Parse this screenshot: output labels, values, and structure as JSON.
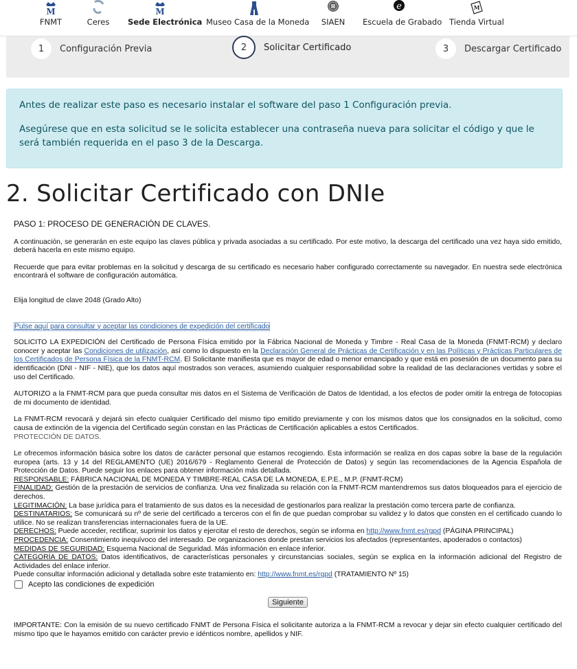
{
  "nav": {
    "items": [
      {
        "label": "FNMT"
      },
      {
        "label": "Ceres"
      },
      {
        "label": "Sede Electrónica"
      },
      {
        "label": "Museo Casa de la Moneda"
      },
      {
        "label": "SIAEN"
      },
      {
        "label": "Escuela de Grabado"
      },
      {
        "label": "Tienda Virtual"
      }
    ]
  },
  "steps": [
    {
      "num": "1",
      "label": "Configuración Previa"
    },
    {
      "num": "2",
      "label": "Solicitar Certificado"
    },
    {
      "num": "3",
      "label": "Descargar Certificado"
    }
  ],
  "alert": {
    "p1": "Antes de realizar este paso es necesario instalar el software del paso 1 Configuración previa.",
    "p2": "Asegúrese que en esta solicitud se le solicita establecer una contraseña nueva para solicitar el código y que le será también requerida en el paso 3 de la Descarga."
  },
  "title": "2. Solicitar Certificado con DNIe",
  "content": {
    "paso1": "PASO 1: PROCESO DE GENERACIÓN DE CLAVES.",
    "intro1": "A continuación, se generarán en este equipo las claves pública y privada asociadas a su certificado. Por este motivo, la descarga del certificado una vez haya sido emitido, deberá hacerla en este mismo equipo.",
    "intro2": "Recuerde que para evitar problemas en la solicitud y descarga de su certificado es necesario haber configurado correctamente su navegador. En nuestra sede electrónica encontrará el software de configuración automática.",
    "key_length": "Elija longitud de clave 2048  (Grado Alto)",
    "conditions_link": "Pulse aquí para consultar y aceptar las condiciones de expedición del certificado",
    "solicito_a": "SOLICITO LA EXPEDICIÓN del Certificado de Persona Física emitido por la Fábrica Nacional de Moneda y Timbre - Real Casa de la Moneda (FNMT-RCM) y declaro conocer y aceptar las ",
    "solicito_link1": "Condiciones de utilización",
    "solicito_b": ", así como lo dispuesto en la ",
    "solicito_link2": "Declaración General de Prácticas de Certificación y en las Políticas y Prácticas Particulares de los Certificados de Persona Física de la FNMT-RCM",
    "solicito_c": ". El Solicitante manifiesta que es mayor de edad o menor emancipado y que está en posesión de un documento para su identificación (DNI - NIF - NIE), que los datos aquí mostrados son veraces, asumiendo cualquier responsabilidad sobre la realidad de las declaraciones vertidas y sobre el uso del Certificado.",
    "autorizo": "AUTORIZO a la FNMT-RCM para que pueda consultar mis datos en el Sistema de Verificación de Datos de Identidad, a los efectos de poder omitir la entrega de fotocopias de mi documento de identidad.",
    "revocara": "La FNMT-RCM revocará y dejará sin efecto cualquier Certificado del mismo tipo emitido previamente y con los mismos datos que los consignados en la solicitud, como causa de extinción de la vigencia del Certificado según constan en las Prácticas de Certificación aplicables a estos Certificados.",
    "proteccion": "PROTECCIÓN DE DATOS.",
    "ofrecemos": "Le ofrecemos información básica sobre los datos de carácter personal que estamos recogiendo. Esta información se realiza en dos capas sobre la base de la regulación europea (arts. 13 y 14 del REGLAMENTO (UE) 2016/679 - Reglamento General de Protección de Datos) y según las recomendaciones de la Agencia Española de Protección de Datos. Puede seguir los enlaces para obtener información más detallada.",
    "responsable_k": "RESPONSABLE:",
    "responsable_v": " FÁBRICA NACIONAL DE MONEDA Y TIMBRE-REAL CASA DE LA MONEDA, E.P.E., M.P. (FNMT-RCM)",
    "finalidad_k": "FINALIDAD:",
    "finalidad_v": " Gestión de la prestación de servicios de confianza. Una vez finalizada su relación con la FNMT-RCM mantendremos sus datos bloqueados para el ejercicio de derechos.",
    "legitimacion_k": "LEGITIMACIÓN:",
    "legitimacion_v": " La base jurídica para el tratamiento de sus datos es la necesidad de gestionarlos para realizar la prestación como tercera parte de confianza.",
    "destinatarios_k": "DESTINATARIOS:",
    "destinatarios_v": " Se comunicará su nº de serie del certificado a terceros con el fin de que puedan comprobar su validez y lo datos que consten en el certificado cuando lo utilice. No se realizan transferencias internacionales fuera de la UE.",
    "derechos_k": "DERECHOS:",
    "derechos_v": " Puede acceder, rectificar, suprimir los datos y ejercitar el resto de derechos, según se informa en ",
    "derechos_link": "http://www.fnmt.es/rgpd",
    "derechos_tail": " (PÁGINA PRINCIPAL)",
    "procedencia_k": "PROCEDENCIA:",
    "procedencia_v": " Consentimiento inequívoco del interesado. De organizaciones donde prestan servicios los afectados (representantes, apoderados o contactos)",
    "medidas_k": "MEDIDAS DE SEGURIDAD:",
    "medidas_v": " Esquema Nacional de Seguridad. Más información en enlace inferior.",
    "categoria_k": "CATEGORÍA DE DATOS:",
    "categoria_v": " Datos identificativos, de características personales y circunstancias sociales, según se explica en la información adicional del Registro de Actividades del enlace inferior.",
    "consultar_a": "Puede consultar información adicional y detallada sobre este tratamiento en: ",
    "consultar_link": "http://www.fnmt.es/rgpd",
    "consultar_tail": " (TRATAMIENTO Nº 15)",
    "accept_label": "Acepto las condiciones de expedición",
    "next_button": "Siguiente",
    "importante_k": "IMPORTANTE:",
    "importante_v": " Con la emisión de su nuevo certificado FNMT de Persona Física el solicitante autoriza a la FNMT-RCM a revocar y dejar sin efecto cualquier certificado del mismo tipo que le hayamos emitido con carácter previo e idénticos nombre, apellidos y NIF."
  }
}
